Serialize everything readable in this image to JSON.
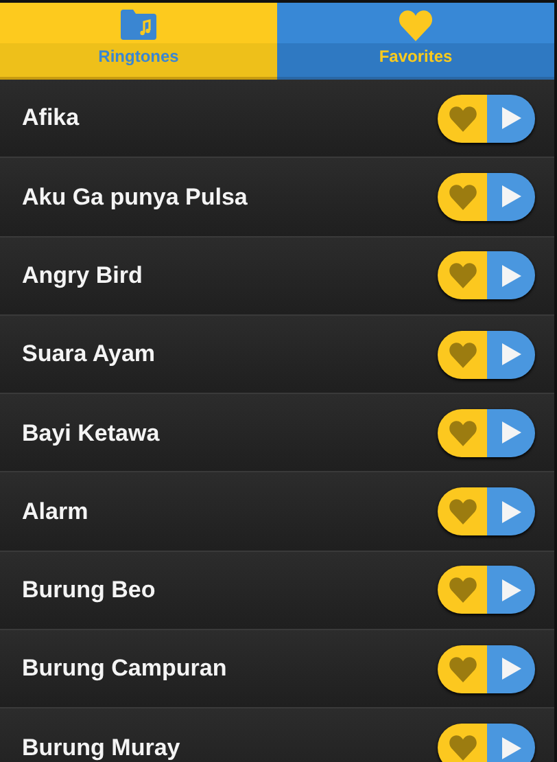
{
  "tabs": [
    {
      "label": "Ringtones",
      "selected": true,
      "kind": "folder"
    },
    {
      "label": "Favorites",
      "selected": false,
      "kind": "heart"
    }
  ],
  "ringtones": [
    {
      "name": "Afika",
      "favorite": false
    },
    {
      "name": "Aku Ga punya Pulsa",
      "favorite": false
    },
    {
      "name": "Angry Bird",
      "favorite": false
    },
    {
      "name": "Suara Ayam",
      "favorite": false
    },
    {
      "name": "Bayi Ketawa",
      "favorite": false
    },
    {
      "name": "Alarm",
      "favorite": false
    },
    {
      "name": "Burung Beo",
      "favorite": false
    },
    {
      "name": "Burung Campuran",
      "favorite": false
    },
    {
      "name": "Burung Muray",
      "favorite": false
    }
  ]
}
